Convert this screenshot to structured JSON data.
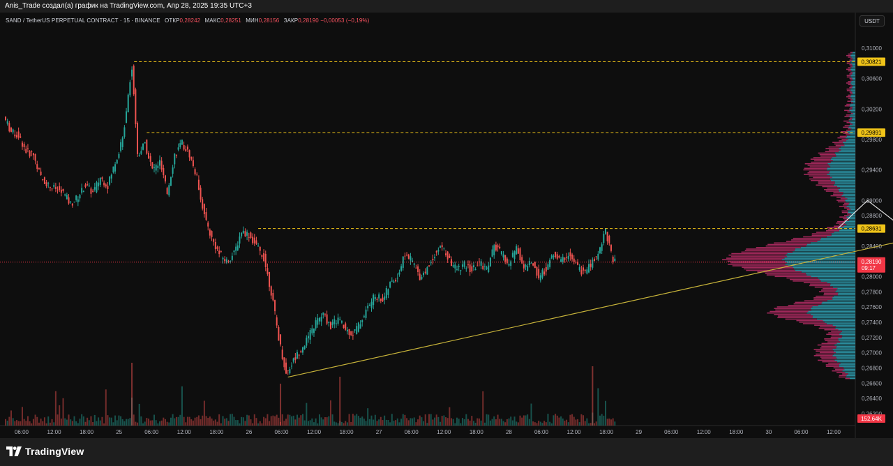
{
  "header": {
    "attribution": "Anis_Trade создал(а) график на TradingView.com, Апр 28, 2025 19:35 UTC+3"
  },
  "legend": {
    "symbol": "SAND / TetherUS PERPETUAL CONTRACT · 15 · BINANCE",
    "open_label": "ОТКР",
    "open": "0,28242",
    "high_label": "МАКС",
    "high": "0,28251",
    "low_label": "МИН",
    "low": "0,28156",
    "close_label": "ЗАКР",
    "close": "0,28190",
    "change": "−0,00053 (−0,19%)"
  },
  "currency_button": "USDT",
  "footer": {
    "brand": "TradingView"
  },
  "colors": {
    "up": "#26a69a",
    "down": "#ef5350",
    "level": "#f0c419",
    "trendline": "#c8b43a",
    "current": "#f23645",
    "profile_up": "#2b8fa0",
    "profile_down": "#a0285a"
  },
  "chart_data": {
    "type": "candlestick",
    "ylim": [
      0.2588,
      0.3117
    ],
    "y_ticks": [
      "0,31000",
      "0,30600",
      "0,30200",
      "0,29800",
      "0,29400",
      "0,29000",
      "0,28800",
      "0,28400",
      "0,28000",
      "0,27800",
      "0,27600",
      "0,27400",
      "0,27200",
      "0,27000",
      "0,26800",
      "0,26600",
      "0,26400",
      "0,26200"
    ],
    "x_ticks": [
      "06:00",
      "12:00",
      "18:00",
      "25",
      "06:00",
      "12:00",
      "18:00",
      "26",
      "06:00",
      "12:00",
      "18:00",
      "27",
      "06:00",
      "12:00",
      "18:00",
      "28",
      "06:00",
      "12:00",
      "18:00",
      "29",
      "06:00",
      "12:00",
      "18:00",
      "30",
      "06:00",
      "12:00"
    ],
    "price_path": [
      [
        0,
        0.301
      ],
      [
        1,
        0.299
      ],
      [
        2,
        0.2985
      ],
      [
        3,
        0.2965
      ],
      [
        4,
        0.296
      ],
      [
        5,
        0.293
      ],
      [
        6,
        0.292
      ],
      [
        7,
        0.2915
      ],
      [
        8,
        0.291
      ],
      [
        9,
        0.2895
      ],
      [
        10,
        0.2905
      ],
      [
        11,
        0.292
      ],
      [
        12,
        0.291
      ],
      [
        13,
        0.293
      ],
      [
        14,
        0.292
      ],
      [
        15,
        0.295
      ],
      [
        16,
        0.298
      ],
      [
        17,
        0.306
      ],
      [
        17.3,
        0.3075
      ],
      [
        18,
        0.296
      ],
      [
        19,
        0.2975
      ],
      [
        20,
        0.294
      ],
      [
        21,
        0.295
      ],
      [
        22,
        0.291
      ],
      [
        23,
        0.296
      ],
      [
        24,
        0.2975
      ],
      [
        25,
        0.296
      ],
      [
        26,
        0.293
      ],
      [
        27,
        0.288
      ],
      [
        28,
        0.285
      ],
      [
        29,
        0.283
      ],
      [
        30,
        0.282
      ],
      [
        31,
        0.283
      ],
      [
        32,
        0.286
      ],
      [
        33,
        0.2855
      ],
      [
        34,
        0.284
      ],
      [
        35,
        0.2825
      ],
      [
        36,
        0.278
      ],
      [
        37,
        0.272
      ],
      [
        38,
        0.2672
      ],
      [
        39,
        0.269
      ],
      [
        40,
        0.2705
      ],
      [
        41,
        0.272
      ],
      [
        42,
        0.274
      ],
      [
        43,
        0.275
      ],
      [
        44,
        0.2735
      ],
      [
        45,
        0.2745
      ],
      [
        46,
        0.273
      ],
      [
        47,
        0.2725
      ],
      [
        48,
        0.274
      ],
      [
        49,
        0.276
      ],
      [
        50,
        0.2775
      ],
      [
        51,
        0.277
      ],
      [
        52,
        0.279
      ],
      [
        53,
        0.28
      ],
      [
        54,
        0.283
      ],
      [
        55,
        0.282
      ],
      [
        56,
        0.28
      ],
      [
        57,
        0.281
      ],
      [
        58,
        0.283
      ],
      [
        59,
        0.284
      ],
      [
        60,
        0.282
      ],
      [
        61,
        0.281
      ],
      [
        62,
        0.2815
      ],
      [
        63,
        0.2808
      ],
      [
        64,
        0.2818
      ],
      [
        65,
        0.281
      ],
      [
        66,
        0.284
      ],
      [
        67,
        0.283
      ],
      [
        68,
        0.2815
      ],
      [
        69,
        0.284
      ],
      [
        70,
        0.281
      ],
      [
        71,
        0.282
      ],
      [
        72,
        0.28
      ],
      [
        73,
        0.281
      ],
      [
        74,
        0.283
      ],
      [
        75,
        0.282
      ],
      [
        76,
        0.283
      ],
      [
        77,
        0.2815
      ],
      [
        78,
        0.2805
      ],
      [
        79,
        0.2815
      ],
      [
        80,
        0.283
      ],
      [
        81,
        0.2862
      ],
      [
        82,
        0.2819
      ]
    ],
    "x_range": [
      0,
      82
    ],
    "horizontal_levels": [
      {
        "price": 0.30821,
        "label": "0,30821",
        "from_x": 17.3
      },
      {
        "price": 0.29891,
        "label": "0,29891",
        "from_x": 19
      },
      {
        "price": 0.28631,
        "label": "0,28631",
        "from_x": 34
      }
    ],
    "current_price": {
      "label": "0,28190",
      "countdown": "09:17",
      "price": 0.2819
    },
    "volume_badge": "152,64K",
    "trendline": {
      "from": [
        38,
        0.2668
      ],
      "to": [
        124,
        0.2854
      ]
    },
    "projection_path": [
      [
        112,
        0.2863
      ],
      [
        116,
        0.29
      ],
      [
        120,
        0.287
      ],
      [
        127,
        0.3098
      ]
    ]
  }
}
